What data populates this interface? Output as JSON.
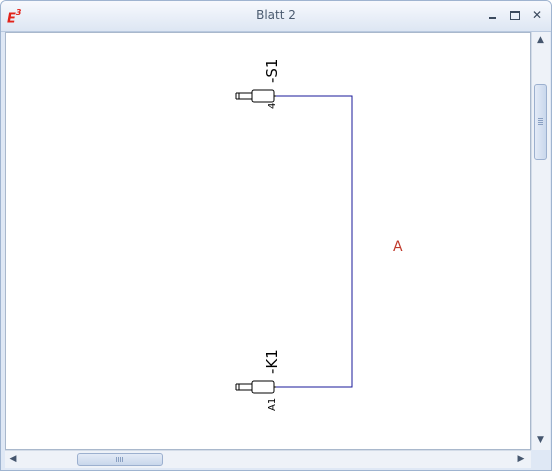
{
  "window": {
    "title": "Blatt 2",
    "app_icon": "e3-logo-icon",
    "controls": [
      "minimize-icon",
      "maximize-icon",
      "close-icon"
    ]
  },
  "schematic": {
    "wire_color": "#1a1a9a",
    "components": [
      {
        "name": "-S1",
        "pin": "4"
      },
      {
        "name": "-K1",
        "pin": "A1"
      }
    ],
    "wire_label": {
      "text": "A",
      "color": "#c0392b"
    }
  },
  "scrollbars": {
    "vertical": {
      "up": "▲",
      "down": "▼"
    },
    "horizontal": {
      "left": "◀",
      "right": "▶"
    }
  }
}
